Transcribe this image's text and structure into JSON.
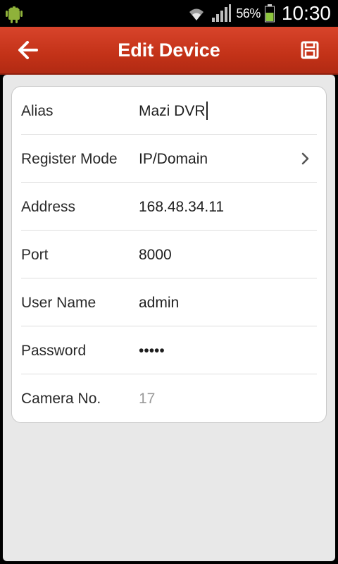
{
  "status_bar": {
    "battery_percent": "56%",
    "time": "10:30",
    "icons": [
      "android-icon",
      "wifi-icon",
      "signal-icon",
      "battery-icon"
    ]
  },
  "header": {
    "title": "Edit Device",
    "back_icon": "back-arrow-icon",
    "save_icon": "save-icon",
    "color": "#c9381c"
  },
  "form": {
    "rows": [
      {
        "label": "Alias",
        "value": "Mazi DVR"
      },
      {
        "label": "Register Mode",
        "value": "IP/Domain"
      },
      {
        "label": "Address",
        "value": "168.48.34.11"
      },
      {
        "label": "Port",
        "value": "8000"
      },
      {
        "label": "User Name",
        "value": "admin"
      },
      {
        "label": "Password",
        "value": "•••••"
      },
      {
        "label": "Camera No.",
        "value": "17"
      }
    ]
  }
}
